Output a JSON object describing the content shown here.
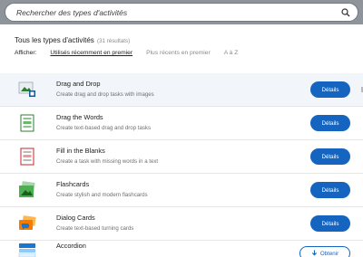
{
  "search": {
    "placeholder": "Rechercher des types d'activités"
  },
  "heading": {
    "title": "Tous les types d'activités",
    "count": "(31 résultats)"
  },
  "sort": {
    "label": "Afficher:",
    "options": [
      "Utilisés récemment en premier",
      "Plus récents en premier",
      "A à Z"
    ],
    "active": "Utilisés récemment en premier"
  },
  "items": [
    {
      "title": "Drag and Drop",
      "description": "Create drag and drop tasks with images",
      "button": "Détails",
      "icon": "drag-and-drop-icon"
    },
    {
      "title": "Drag the Words",
      "description": "Create text-based drag and drop tasks",
      "button": "Détails",
      "icon": "drag-the-words-icon"
    },
    {
      "title": "Fill in the Blanks",
      "description": "Create a task with missing words in a text",
      "button": "Détails",
      "icon": "fill-in-the-blanks-icon"
    },
    {
      "title": "Flashcards",
      "description": "Create stylish and modern flashcards",
      "button": "Détails",
      "icon": "flashcards-icon"
    },
    {
      "title": "Dialog Cards",
      "description": "Create text-based turning cards",
      "button": "Détails",
      "icon": "dialog-cards-icon"
    },
    {
      "title": "Accordion",
      "description": "",
      "button": "Obtenir",
      "icon": "accordion-icon"
    }
  ],
  "colors": {
    "primary": "#1565c0",
    "header_bg": "#8f949b",
    "highlight_row": "#f2f6fa"
  }
}
